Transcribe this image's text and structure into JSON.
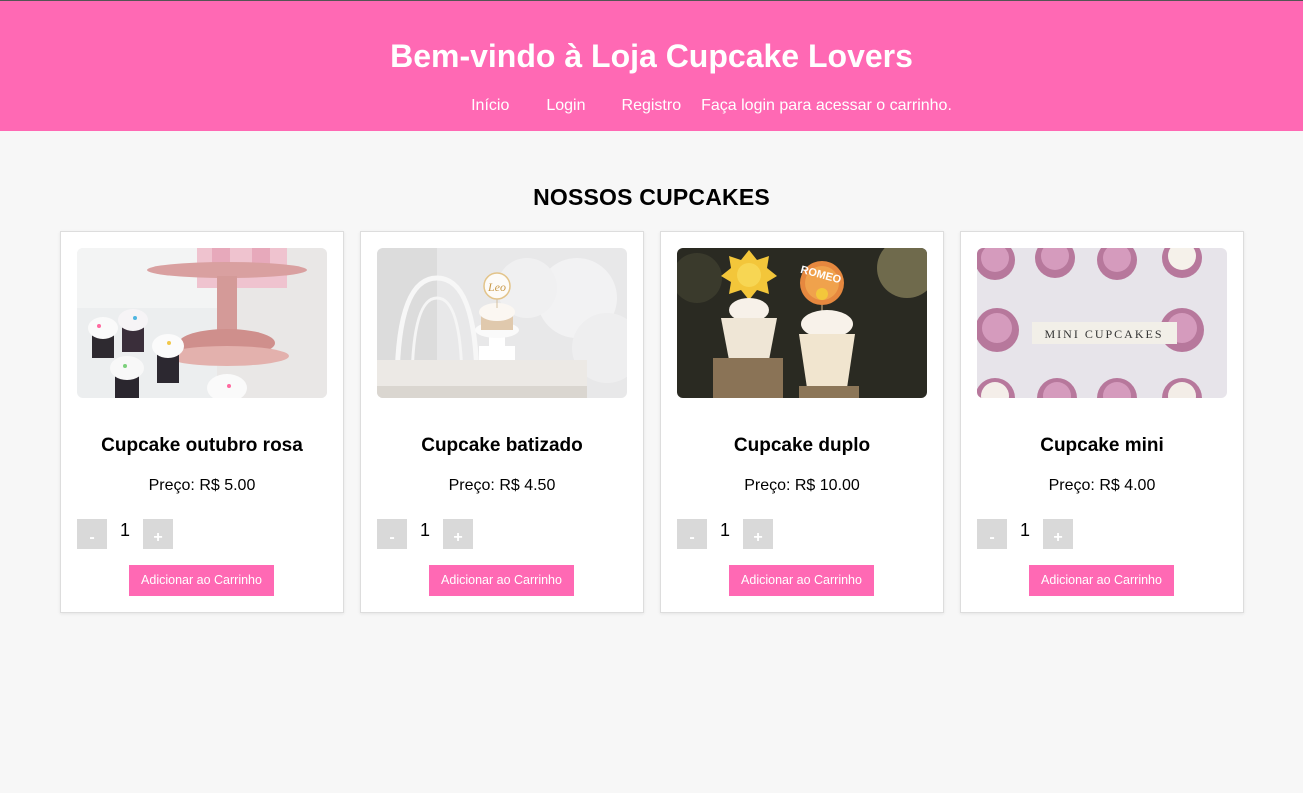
{
  "header": {
    "title": "Bem-vindo à Loja Cupcake Lovers",
    "nav": {
      "inicio": "Início",
      "login": "Login",
      "registro": "Registro",
      "message": "Faça login para acessar o carrinho."
    }
  },
  "main": {
    "section_title": "NOSSOS CUPCAKES",
    "products": [
      {
        "name": "Cupcake outubro rosa",
        "price": "Preço: R$ 5.00",
        "quantity": "1",
        "minus_label": "-",
        "plus_label": "+",
        "add_label": "Adicionar ao Carrinho"
      },
      {
        "name": "Cupcake batizado",
        "price": "Preço: R$ 4.50",
        "quantity": "1",
        "minus_label": "-",
        "plus_label": "+",
        "add_label": "Adicionar ao Carrinho",
        "topper_text": "Leo"
      },
      {
        "name": "Cupcake duplo",
        "price": "Preço: R$ 10.00",
        "quantity": "1",
        "minus_label": "-",
        "plus_label": "+",
        "add_label": "Adicionar ao Carrinho",
        "topper_text": "ROMEO"
      },
      {
        "name": "Cupcake mini",
        "price": "Preço: R$ 4.00",
        "quantity": "1",
        "minus_label": "-",
        "plus_label": "+",
        "add_label": "Adicionar ao Carrinho",
        "banner_text": "MINI CUPCAKES"
      }
    ]
  },
  "colors": {
    "brand_pink": "#ff69b4",
    "page_background": "#f7f7f7",
    "qty_button": "#d9d9d9"
  }
}
